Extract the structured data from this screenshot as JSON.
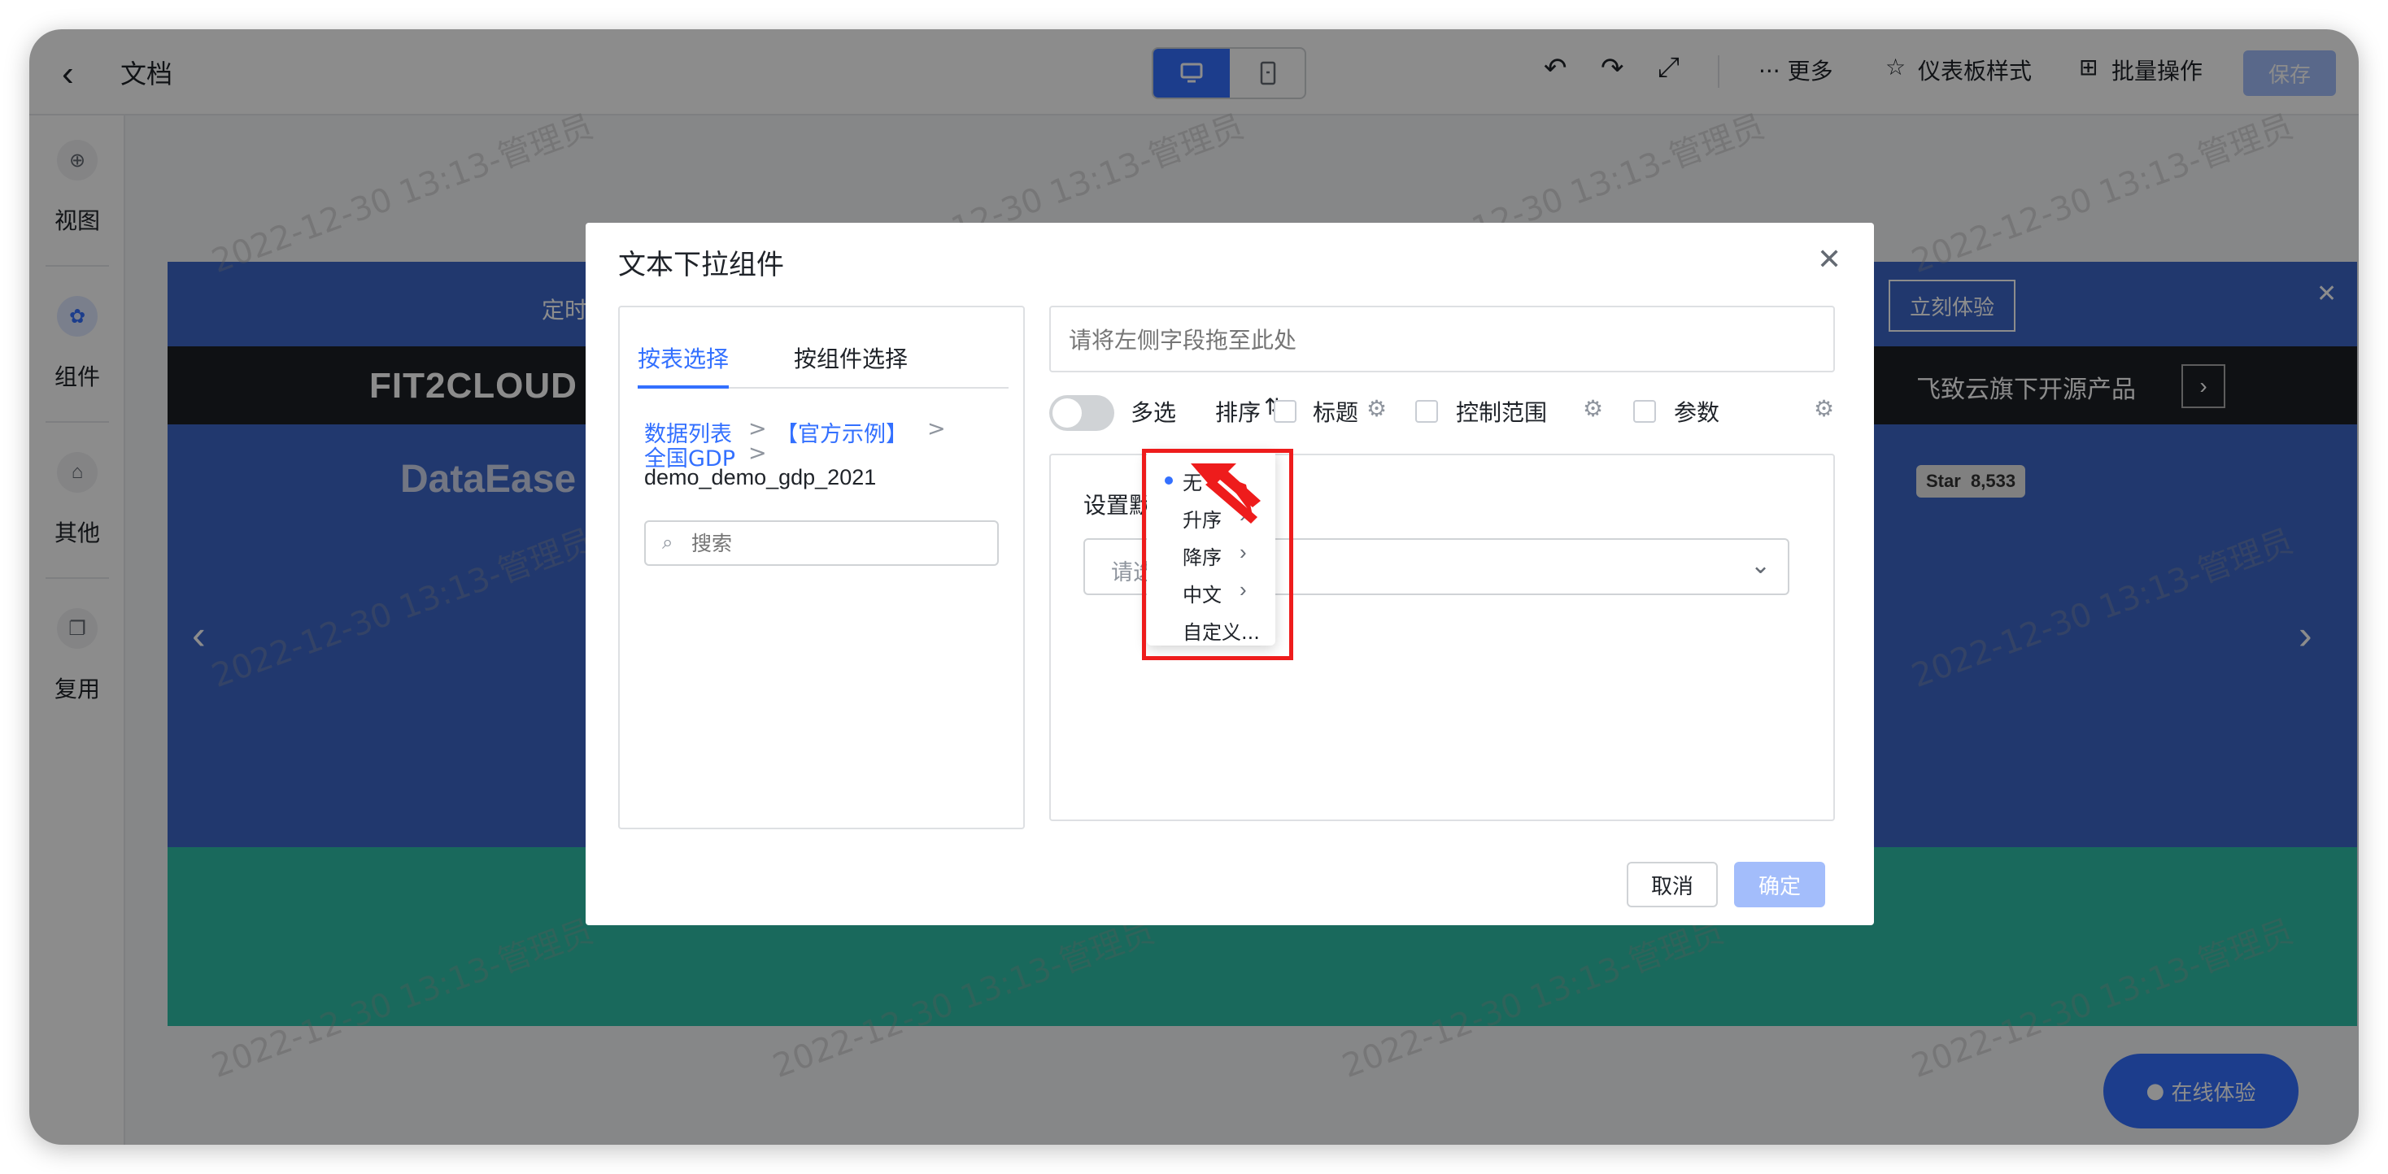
{
  "header": {
    "back_icon": "chevron-left-icon",
    "title": "文档",
    "more_label": "··· 更多",
    "dashboard_style_label": "仪表板样式",
    "batch_label": "批量操作",
    "save_label": "保存"
  },
  "sidebar": {
    "items": [
      {
        "label": "视图",
        "icon": "plus-circle-icon"
      },
      {
        "label": "组件",
        "icon": "gear-icon"
      },
      {
        "label": "其他",
        "icon": "box-icon"
      },
      {
        "label": "复用",
        "icon": "copy-icon"
      }
    ]
  },
  "banner": {
    "brand": "FIT2CLOUD",
    "brand2": "DataEase",
    "ding_text": "定时",
    "try_label": "立刻体验",
    "open_source_text": "飞致云旗下开源产品",
    "star_label": "Star",
    "star_count": "8,533",
    "float_button": "在线体验"
  },
  "watermark": "2022-12-30 13:13-管理员",
  "dialog": {
    "title": "文本下拉组件",
    "tabs": [
      {
        "label": "按表选择"
      },
      {
        "label": "按组件选择"
      }
    ],
    "breadcrumb": {
      "item1": "数据列表",
      "item2": "【官方示例】",
      "item3": "全国GDP",
      "table": "demo_demo_gdp_2021",
      "sep": ">"
    },
    "search_placeholder": "搜索",
    "drop_placeholder": "请将左侧字段拖至此处",
    "options": {
      "multi": "多选",
      "sort": "排序",
      "title": "标题",
      "control_range": "控制范围",
      "params": "参数"
    },
    "default_label": "设置默认值",
    "default_label_visible": "设置默",
    "select_placeholder": "请选",
    "sort_menu": [
      {
        "label": "无",
        "selected": true,
        "has_sub": false
      },
      {
        "label": "升序",
        "selected": false,
        "has_sub": true
      },
      {
        "label": "降序",
        "selected": false,
        "has_sub": true
      },
      {
        "label": "中文",
        "selected": false,
        "has_sub": true
      },
      {
        "label": "自定义...",
        "selected": false,
        "has_sub": false
      }
    ],
    "cancel_label": "取消",
    "ok_label": "确定"
  },
  "colors": {
    "accent": "#3370ff",
    "annotation": "#ee1c1c",
    "banner": "#3d67c9",
    "teal": "#2fbfa8"
  }
}
